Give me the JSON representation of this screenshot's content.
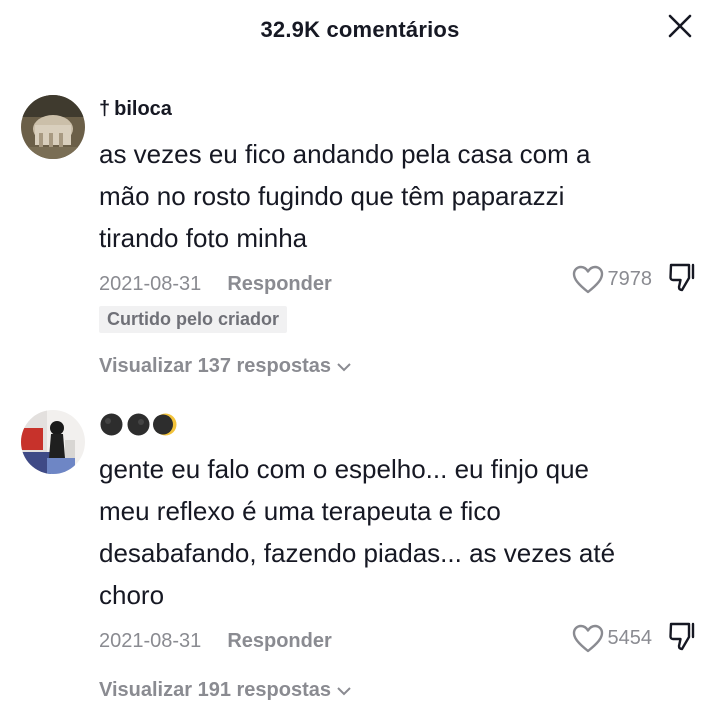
{
  "header": {
    "title": "32.9K comentários"
  },
  "comments": [
    {
      "username": "biloca",
      "username_prefix_glyph": "†",
      "text_lines": [
        "as vezes eu fico andando pela casa com a",
        "mão no rosto fugindo que têm paparazzi",
        "tirando foto minha"
      ],
      "date": "2021-08-31",
      "reply_label": "Responder",
      "likes": "7978",
      "badge": "Curtido pelo criador",
      "view_replies": "Visualizar 137 respostas"
    },
    {
      "username_icons": [
        "dark-moon-icon",
        "dark-moon-icon",
        "crescent-moon-icon"
      ],
      "text_lines": [
        "gente eu falo com o espelho... eu finjo que",
        "meu reflexo é uma terapeuta e fico",
        "desabafando, fazendo piadas... as vezes até",
        "choro"
      ],
      "date": "2021-08-31",
      "reply_label": "Responder",
      "likes": "5454",
      "view_replies": "Visualizar 191 respostas"
    }
  ],
  "colors": {
    "primary_text": "#161823",
    "secondary_text": "#8a8b91",
    "badge_bg": "#f1f1f2"
  }
}
